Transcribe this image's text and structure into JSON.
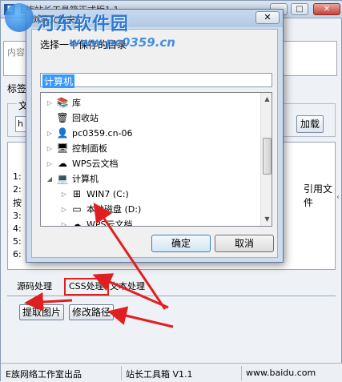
{
  "app": {
    "title": "E族站长工具箱正式版1.1",
    "desc_text": "内容",
    "tag_label": "标签",
    "group_legend": "文",
    "url_value": "h",
    "load_button": "加载",
    "output_lines": [
      "1:",
      "2:",
      "按",
      "3:",
      "4:",
      "5:",
      "6:"
    ],
    "output_right_text": "引用文件",
    "tabs": [
      "源码处理",
      "CSS处理",
      "文本处理"
    ],
    "buttons": {
      "extract": "提取图片",
      "modify_path": "修改路径"
    },
    "status": {
      "company": "E族网络工作室出品",
      "product": "站长工具箱 V1.1",
      "site": "www.baidu.com"
    },
    "caption_buttons": {
      "minimize": "▁",
      "maximize": "□",
      "close": "✕"
    }
  },
  "dialog": {
    "title": "浏览文件夹",
    "instruction": "选择一个保存的目录",
    "path": "计算机",
    "close": "✕",
    "tree": [
      {
        "label": "库",
        "icon": "library-icon",
        "glyph": "📚",
        "level": 0,
        "expander": "▷"
      },
      {
        "label": "回收站",
        "icon": "recycle-bin-icon",
        "glyph": "🗑",
        "level": 0,
        "expander": ""
      },
      {
        "label": "pc0359.cn-06",
        "icon": "user-folder-icon",
        "glyph": "👤",
        "level": 0,
        "expander": "▷"
      },
      {
        "label": "控制面板",
        "icon": "control-panel-icon",
        "glyph": "🖥",
        "level": 0,
        "expander": "▷"
      },
      {
        "label": "WPS云文档",
        "icon": "cloud-icon",
        "glyph": "☁",
        "level": 0,
        "expander": "▷"
      },
      {
        "label": "计算机",
        "icon": "computer-icon",
        "glyph": "💻",
        "level": 0,
        "expander": "◢"
      },
      {
        "label": "WIN7 (C:)",
        "icon": "windows-drive-icon",
        "glyph": "⊞",
        "level": 1,
        "expander": "▷"
      },
      {
        "label": "本地磁盘 (D:)",
        "icon": "disk-drive-icon",
        "glyph": "▭",
        "level": 1,
        "expander": "▷"
      },
      {
        "label": "WPS云文档",
        "icon": "cloud-icon",
        "glyph": "☁",
        "level": 1,
        "expander": "▷"
      }
    ],
    "ok_button": "确定",
    "cancel_button": "取消"
  },
  "watermark": {
    "title": "河东软件园",
    "url": "www.pc0359.cn"
  },
  "colors": {
    "highlight": "#3399ff",
    "annotation_red": "#e02020",
    "watermark_blue": "#1e6fd0"
  }
}
